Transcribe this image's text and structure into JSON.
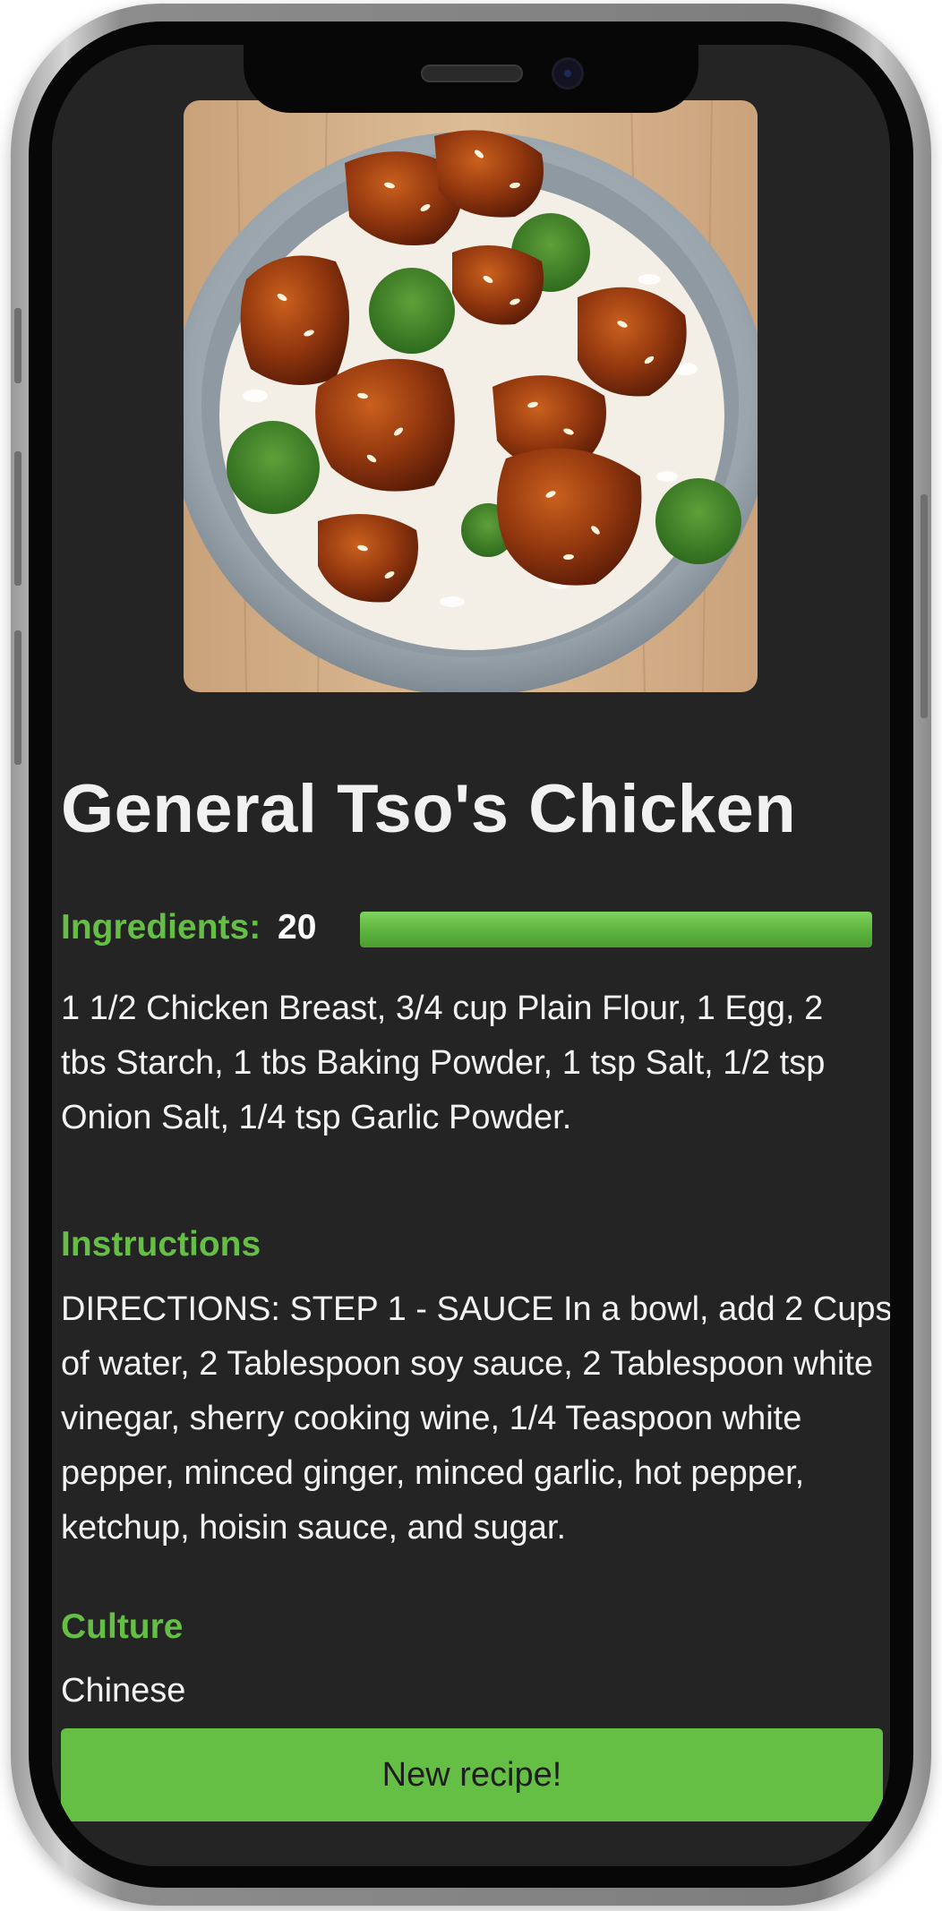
{
  "recipe": {
    "image_subject": "general-tsos-chicken-bowl",
    "title": "General Tso's Chicken",
    "ingredients_label": "Ingredients:",
    "ingredients_count": "20",
    "ingredients_bar_fill_percent": 100,
    "ingredients_text": "1 1/2 Chicken Breast, 3/4 cup Plain Flour, 1 Egg, 2 tbs Starch, 1 tbs Baking Powder, 1 tsp Salt, 1/2 tsp Onion Salt, 1/4 tsp Garlic Powder.",
    "instructions_heading": "Instructions",
    "instructions_text": "DIRECTIONS: STEP 1 - SAUCE In a bowl, add 2 Cups of water, 2 Tablespoon soy sauce, 2 Tablespoon white vinegar, sherry cooking wine, 1/4 Teaspoon white pepper, minced ginger, minced garlic, hot pepper, ketchup, hoisin sauce, and sugar.",
    "culture_heading": "Culture",
    "culture_text": "Chinese",
    "new_recipe_button": "New recipe!"
  },
  "colors": {
    "accent_green": "#65bf45",
    "screen_background": "#242424",
    "text_light": "#f2f2f2"
  }
}
